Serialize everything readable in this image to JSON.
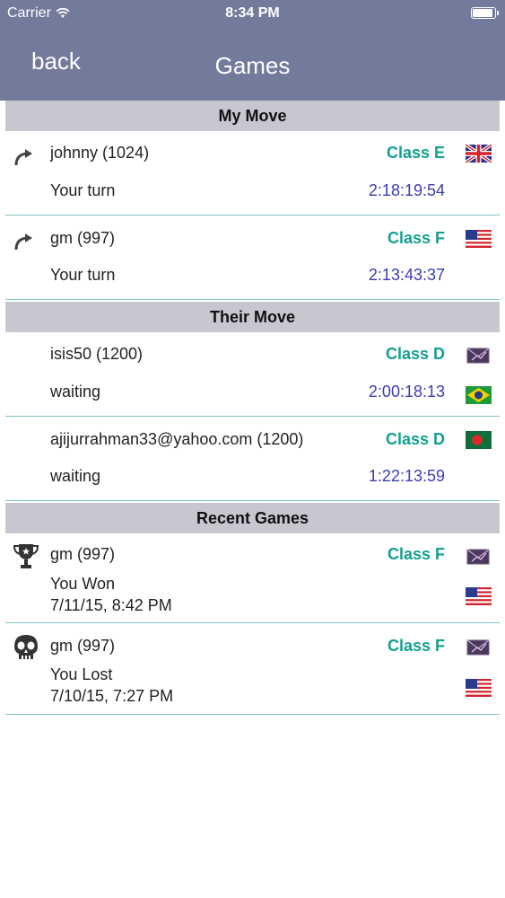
{
  "status": {
    "carrier": "Carrier",
    "time": "8:34 PM"
  },
  "nav": {
    "back": "back",
    "title": "Games"
  },
  "sections": {
    "my_move": "My Move",
    "their_move": "Their Move",
    "recent": "Recent Games"
  },
  "my_move_rows": [
    {
      "name": "johnny (1024)",
      "class": "Class E",
      "status": "Your turn",
      "timer": "2:18:19:54",
      "flag": "uk-flag-icon"
    },
    {
      "name": "gm (997)",
      "class": "Class F",
      "status": "Your turn",
      "timer": "2:13:43:37",
      "flag": "us-flag-icon"
    }
  ],
  "their_move_rows": [
    {
      "name": "isis50 (1200)",
      "class": "Class D",
      "status": "waiting",
      "timer": "2:00:18:13",
      "flag": "brazil-flag-icon"
    },
    {
      "name": "ajijurrahman33@yahoo.com (1200)",
      "class": "Class D",
      "status": "waiting",
      "timer": "1:22:13:59",
      "flag": "bangladesh-flag-icon"
    }
  ],
  "recent_rows": [
    {
      "name": "gm (997)",
      "class": "Class F",
      "result": "You Won",
      "date": "7/11/15, 8:42 PM",
      "icon": "trophy-icon",
      "flag": "us-flag-icon"
    },
    {
      "name": "gm (997)",
      "class": "Class F",
      "result": "You Lost",
      "date": "7/10/15, 7:27 PM",
      "icon": "skull-icon",
      "flag": "us-flag-icon"
    }
  ]
}
